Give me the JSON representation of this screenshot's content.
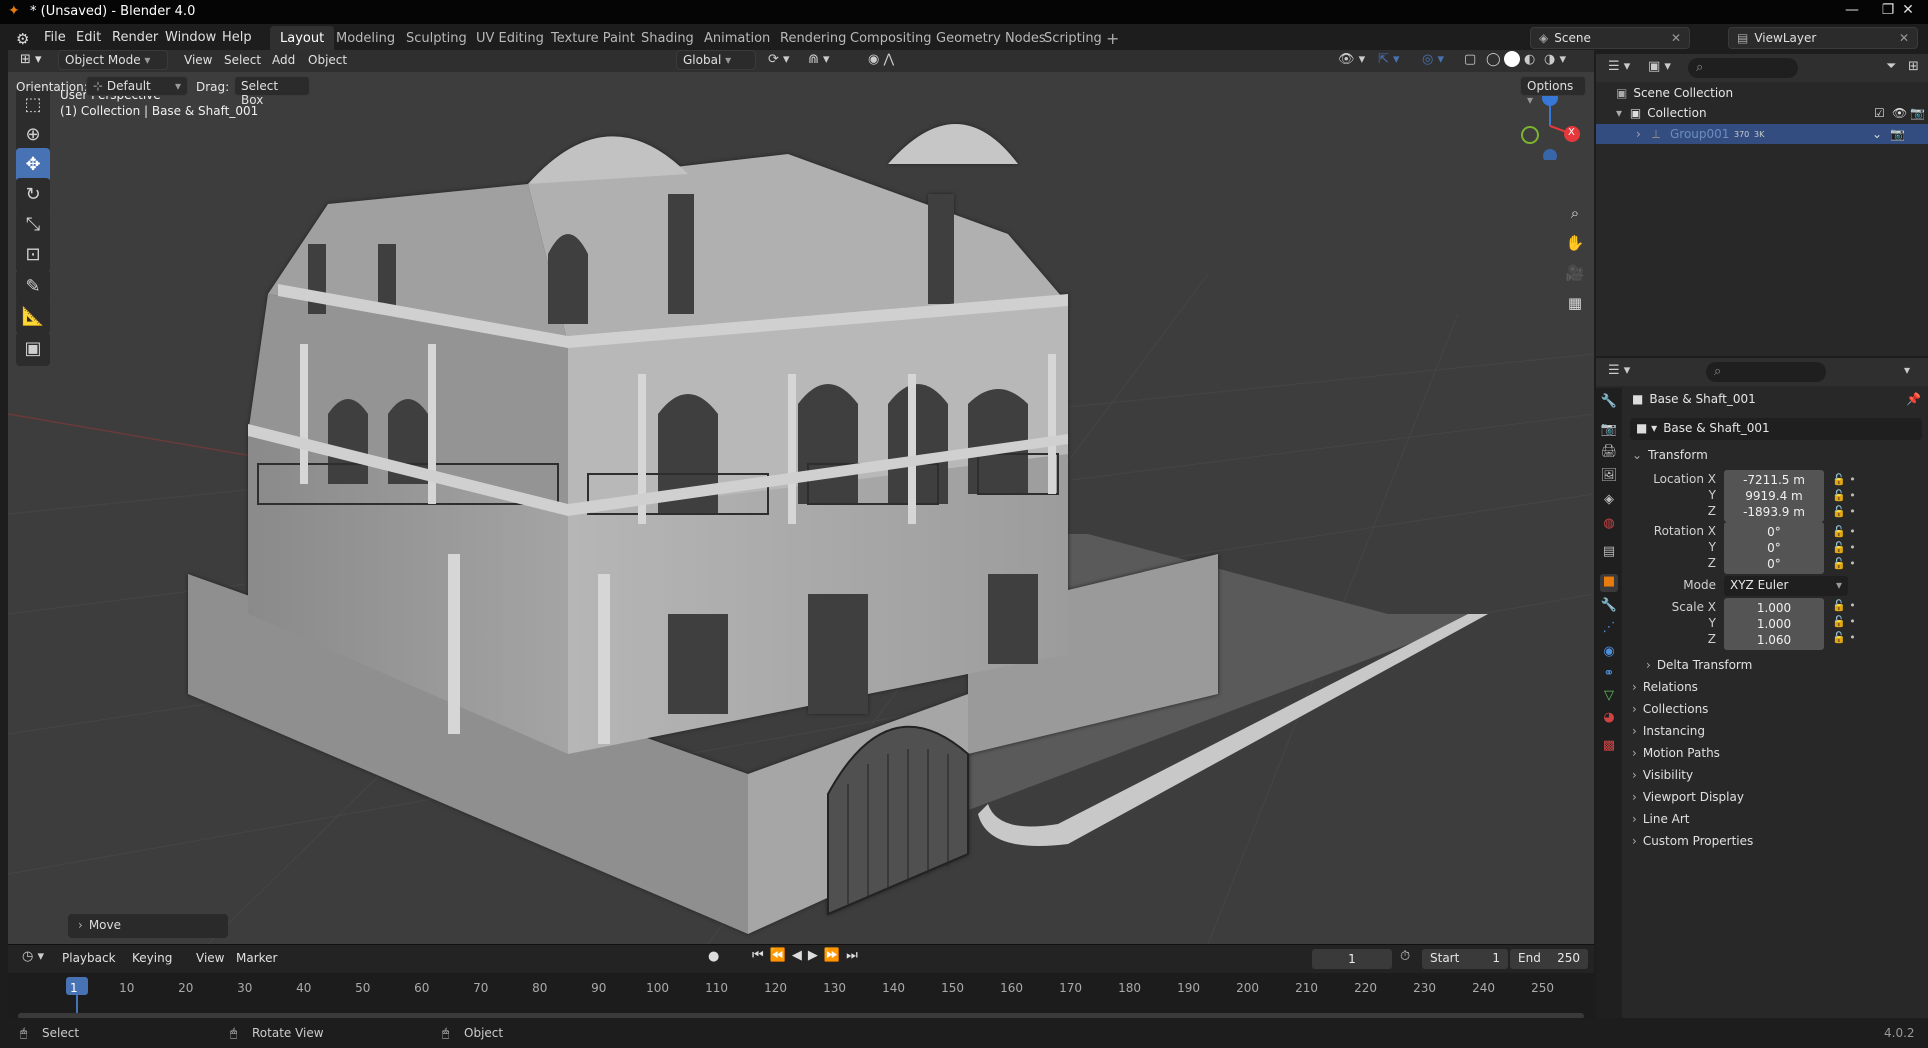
{
  "window": {
    "title": "* (Unsaved) - Blender 4.0"
  },
  "menus": [
    "File",
    "Edit",
    "Render",
    "Window",
    "Help"
  ],
  "workspaces": [
    "Layout",
    "Modeling",
    "Sculpting",
    "UV Editing",
    "Texture Paint",
    "Shading",
    "Animation",
    "Rendering",
    "Compositing",
    "Geometry Nodes",
    "Scripting"
  ],
  "scene": {
    "label": "Scene",
    "view_layer": "ViewLayer"
  },
  "viewport": {
    "mode": "Object Mode",
    "menus": [
      "View",
      "Select",
      "Add",
      "Object"
    ],
    "transform_orientation": "Global",
    "orientation_label": "Orientation:",
    "orientation_value": "Default",
    "drag_label": "Drag:",
    "drag_value": "Select Box",
    "options": "Options",
    "perspective": "User Perspective",
    "collection_info": "(1) Collection | Base & Shaft_001",
    "last_op": "Move",
    "gizmo": {
      "x": "X",
      "y": "Y",
      "z": "Z"
    }
  },
  "outliner": {
    "scene_collection": "Scene Collection",
    "collection": "Collection",
    "group": "Group001",
    "group_badge1": "370",
    "group_badge2": "3K"
  },
  "properties": {
    "object_name": "Base & Shaft_001",
    "data_name": "Base & Shaft_001",
    "transform_header": "Transform",
    "location_label": "Location X",
    "location": {
      "x": "-7211.5 m",
      "y": "9919.4 m",
      "z": "-1893.9 m"
    },
    "rotation_label": "Rotation X",
    "rotation": {
      "x": "0°",
      "y": "0°",
      "z": "0°"
    },
    "mode_label": "Mode",
    "mode": "XYZ Euler",
    "scale_label": "Scale X",
    "scale": {
      "x": "1.000",
      "y": "1.000",
      "z": "1.060"
    },
    "y_label": "Y",
    "z_label": "Z",
    "sections": [
      "Delta Transform",
      "Relations",
      "Collections",
      "Instancing",
      "Motion Paths",
      "Visibility",
      "Viewport Display",
      "Line Art",
      "Custom Properties"
    ]
  },
  "timeline": {
    "menus": [
      "Playback",
      "Keying",
      "View",
      "Marker"
    ],
    "current_frame": "1",
    "start_label": "Start",
    "start": "1",
    "end_label": "End",
    "end": "250",
    "ticks": [
      "1",
      "10",
      "20",
      "30",
      "40",
      "50",
      "60",
      "70",
      "80",
      "90",
      "100",
      "110",
      "120",
      "130",
      "140",
      "150",
      "160",
      "170",
      "180",
      "190",
      "200",
      "210",
      "220",
      "230",
      "240",
      "250"
    ]
  },
  "status": {
    "select": "Select",
    "rotate": "Rotate View",
    "object": "Object",
    "version": "4.0.2"
  },
  "colors": {
    "accent": "#4772b3",
    "viewport_bg": "#3d3d3d",
    "panel_bg": "#282828",
    "x_axis": "#e5383b",
    "y_axis": "#7bb331",
    "z_axis": "#3777d6"
  }
}
